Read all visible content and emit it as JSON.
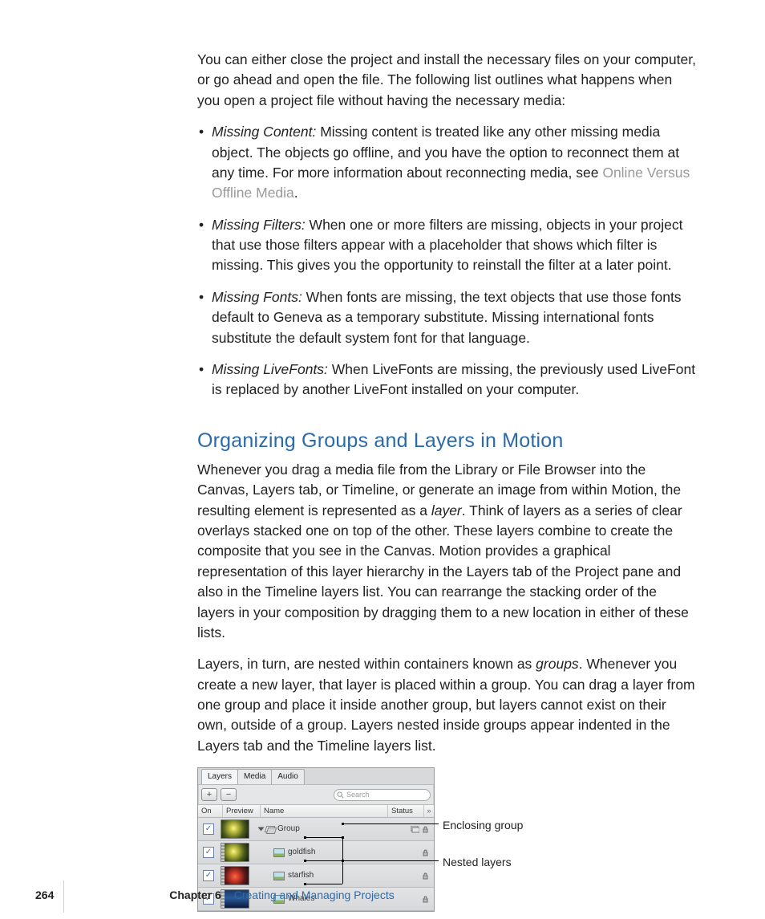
{
  "intro": "You can either close the project and install the necessary files on your computer, or go ahead and open the file. The following list outlines what happens when you open a project file without having the necessary media:",
  "bullets": [
    {
      "term": "Missing Content:",
      "text_a": "  Missing content is treated like any other missing media object. The objects go offline, and you have the option to reconnect them at any time. For more information about reconnecting media, see ",
      "link": "Online Versus Offline Media",
      "text_b": "."
    },
    {
      "term": "Missing Filters:",
      "text_a": "  When one or more filters are missing, objects in your project that use those filters appear with a placeholder that shows which filter is missing. This gives you the opportunity to reinstall the filter at a later point.",
      "link": "",
      "text_b": ""
    },
    {
      "term": "Missing Fonts:",
      "text_a": "  When fonts are missing, the text objects that use those fonts default to Geneva as a temporary substitute. Missing international fonts substitute the default system font for that language.",
      "link": "",
      "text_b": ""
    },
    {
      "term": "Missing LiveFonts:",
      "text_a": "  When LiveFonts are missing, the previously used LiveFont is replaced by another LiveFont installed on your computer.",
      "link": "",
      "text_b": ""
    }
  ],
  "section_title": "Organizing Groups and Layers in Motion",
  "section_p1_a": "Whenever you drag a media file from the Library or File Browser into the Canvas, Layers tab, or Timeline, or generate an image from within Motion, the resulting element is represented as a ",
  "section_p1_i": "layer",
  "section_p1_b": ". Think of layers as a series of clear overlays stacked one on top of the other. These layers combine to create the composite that you see in the Canvas. Motion provides a graphical representation of this layer hierarchy in the Layers tab of the Project pane and also in the Timeline layers list. You can rearrange the stacking order of the layers in your composition by dragging them to a new location in either of these lists.",
  "section_p2_a": "Layers, in turn, are nested within containers known as ",
  "section_p2_i": "groups",
  "section_p2_b": ". Whenever you create a new layer, that layer is placed within a group. You can drag a layer from one group and place it inside another group, but layers cannot exist on their own, outside of a group. Layers nested inside groups appear indented in the Layers tab and the Timeline layers list.",
  "panel": {
    "tabs": [
      "Layers",
      "Media",
      "Audio"
    ],
    "search_placeholder": "Search",
    "headers": {
      "on": "On",
      "preview": "Preview",
      "name": "Name",
      "status": "Status"
    },
    "rows": [
      {
        "name": "Group",
        "indent": 0,
        "kind": "group",
        "thumb": "green"
      },
      {
        "name": "goldfish",
        "indent": 1,
        "kind": "layer",
        "thumb": "green"
      },
      {
        "name": "starfish",
        "indent": 1,
        "kind": "layer",
        "thumb": "red"
      },
      {
        "name": "Whales",
        "indent": 1,
        "kind": "layer",
        "thumb": "blue"
      }
    ]
  },
  "callouts": {
    "group": "Enclosing group",
    "layers": "Nested layers"
  },
  "footer": {
    "page": "264",
    "chapter_label": "Chapter 6",
    "chapter_title": "Creating and Managing Projects"
  }
}
